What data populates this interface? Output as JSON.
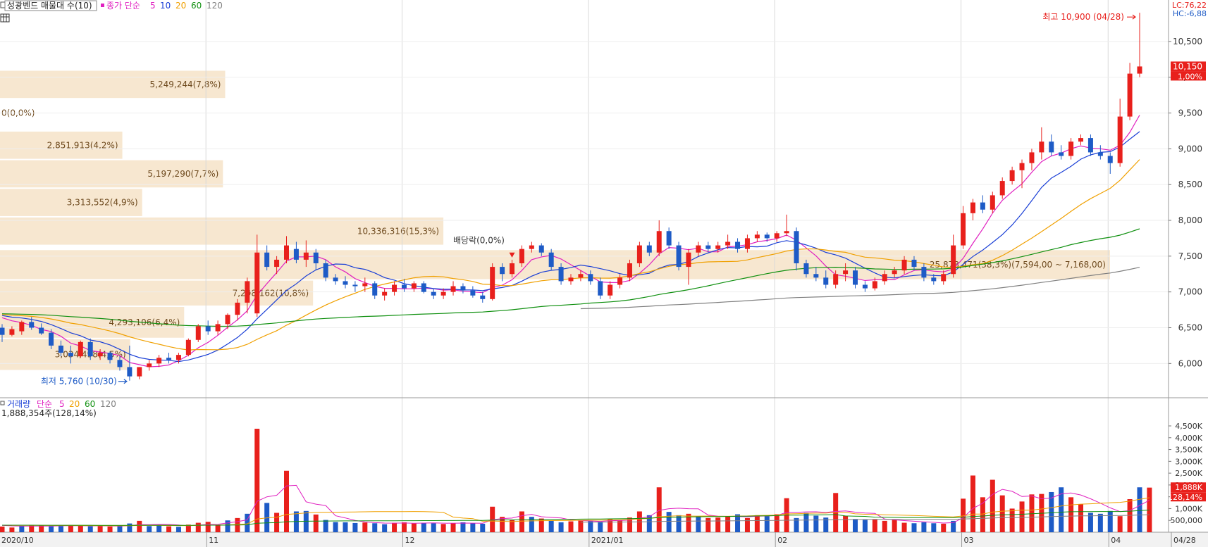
{
  "price_header": {
    "title": "성광벤드 매물대 수(10)",
    "ma_title": "종가 단순",
    "ma_periods": [
      "5",
      "10",
      "20",
      "60",
      "120"
    ],
    "ma_colors": [
      "#e020c0",
      "#1a3fd6",
      "#f0a000",
      "#109010",
      "#808080"
    ]
  },
  "volume_header": {
    "title": "거래량",
    "ma_title": "단순",
    "ma_periods": [
      "5",
      "20",
      "60",
      "120"
    ],
    "ma_colors": [
      "#e020c0",
      "#f0a000",
      "#109010",
      "#808080"
    ],
    "current": "1,888,354주(128,14%)"
  },
  "right_labels": {
    "lc": "LC:76,22",
    "hc": "HC:-6,88",
    "price_tag": "10,150",
    "pct_tag": "1,00%",
    "vol_tag": "1,888K",
    "vol_pct_tag": "128,14%"
  },
  "annotations": {
    "high": "최고 10,900 (04/28)",
    "low": "최저 5,760 (10/30)",
    "dividend": "배당락(0,0%)"
  },
  "colors": {
    "up": "#e8201c",
    "down": "#1e5bc6",
    "volume_profile": "#f7e7d0",
    "volume_profile_text": "#6e4a1e"
  },
  "chart_data": {
    "type": "candlestick",
    "x_axis_labels": [
      "2020/10",
      "11",
      "12",
      "2021/01",
      "02",
      "03",
      "04",
      "04/28"
    ],
    "y_price_ticks": [
      "10,500",
      "10,000",
      "9,500",
      "9,000",
      "8,500",
      "8,000",
      "7,500",
      "7,000",
      "6,500",
      "6,000"
    ],
    "y_volume_ticks": [
      "4,500K",
      "4,000K",
      "3,500K",
      "3,000K",
      "2,500K",
      "2,000K",
      "1,500K",
      "1,000K",
      "500,000"
    ],
    "price_range": [
      5600,
      11000
    ],
    "volume_range": [
      0,
      4500000
    ],
    "volume_profile": [
      {
        "label": "5,249,244(7,8%)",
        "lo": 9700,
        "hi": 10100
      },
      {
        "label": "0(0,0%)",
        "lo": 9300,
        "hi": 9700
      },
      {
        "label": "2,851,913(4,2%)",
        "lo": 8850,
        "hi": 9250
      },
      {
        "label": "5,197,290(7,7%)",
        "lo": 8450,
        "hi": 8850
      },
      {
        "label": "3,313,552(4,9%)",
        "lo": 8050,
        "hi": 8450
      },
      {
        "label": "10,336,316(15,3%)",
        "lo": 7650,
        "hi": 8050
      },
      {
        "label": "25,878,471(38,3%)(7,594,00 ~ 7,168,00)",
        "lo": 7168,
        "hi": 7594
      },
      {
        "label": "7,298,162(10,8%)",
        "lo": 6800,
        "hi": 7168
      },
      {
        "label": "4,293,106(6,4%)",
        "lo": 6350,
        "hi": 6800
      },
      {
        "label": "3,034,498(4,5%)",
        "lo": 5900,
        "hi": 6350
      }
    ],
    "ohlc": [
      [
        6500,
        6550,
        6300,
        6400
      ],
      [
        6400,
        6520,
        6380,
        6480
      ],
      [
        6450,
        6600,
        6400,
        6580
      ],
      [
        6580,
        6650,
        6470,
        6500
      ],
      [
        6500,
        6560,
        6400,
        6420
      ],
      [
        6430,
        6480,
        6200,
        6250
      ],
      [
        6250,
        6320,
        6100,
        6150
      ],
      [
        6150,
        6250,
        6000,
        6100
      ],
      [
        6100,
        6320,
        6080,
        6300
      ],
      [
        6300,
        6350,
        6050,
        6100
      ],
      [
        6100,
        6200,
        6050,
        6150
      ],
      [
        6150,
        6170,
        6000,
        6050
      ],
      [
        6050,
        6100,
        5900,
        5950
      ],
      [
        5950,
        6250,
        5760,
        5820
      ],
      [
        5820,
        5950,
        5780,
        5950
      ],
      [
        5950,
        6050,
        5900,
        6000
      ],
      [
        6000,
        6120,
        5950,
        6080
      ],
      [
        6080,
        6150,
        6000,
        6050
      ],
      [
        6050,
        6150,
        6000,
        6120
      ],
      [
        6120,
        6350,
        6100,
        6330
      ],
      [
        6330,
        6550,
        6300,
        6520
      ],
      [
        6520,
        6600,
        6400,
        6450
      ],
      [
        6450,
        6600,
        6400,
        6550
      ],
      [
        6550,
        6700,
        6480,
        6680
      ],
      [
        6680,
        6900,
        6600,
        6850
      ],
      [
        6850,
        7200,
        6700,
        7150
      ],
      [
        6700,
        7800,
        6650,
        7550
      ],
      [
        7550,
        7650,
        7300,
        7350
      ],
      [
        7350,
        7500,
        7250,
        7450
      ],
      [
        7450,
        7780,
        7400,
        7650
      ],
      [
        7600,
        7700,
        7400,
        7450
      ],
      [
        7450,
        7720,
        7350,
        7550
      ],
      [
        7550,
        7600,
        7300,
        7400
      ],
      [
        7400,
        7450,
        7150,
        7200
      ],
      [
        7200,
        7250,
        7100,
        7150
      ],
      [
        7150,
        7220,
        7050,
        7100
      ],
      [
        7100,
        7150,
        7000,
        7080
      ],
      [
        7080,
        7200,
        7000,
        7120
      ],
      [
        7120,
        7150,
        6900,
        6950
      ],
      [
        6950,
        7050,
        6880,
        7000
      ],
      [
        7000,
        7150,
        6950,
        7100
      ],
      [
        7100,
        7180,
        7000,
        7050
      ],
      [
        7050,
        7150,
        7000,
        7120
      ],
      [
        7120,
        7150,
        6980,
        7000
      ],
      [
        7000,
        7050,
        6900,
        6950
      ],
      [
        6950,
        7050,
        6900,
        7000
      ],
      [
        7000,
        7150,
        6950,
        7080
      ],
      [
        7080,
        7120,
        6980,
        7020
      ],
      [
        7020,
        7080,
        6920,
        6950
      ],
      [
        6950,
        7000,
        6850,
        6900
      ],
      [
        6900,
        7400,
        6880,
        7350
      ],
      [
        7350,
        7400,
        7150,
        7250
      ],
      [
        7250,
        7450,
        7200,
        7400
      ],
      [
        7400,
        7650,
        7350,
        7600
      ],
      [
        7600,
        7700,
        7550,
        7650
      ],
      [
        7650,
        7680,
        7500,
        7550
      ],
      [
        7550,
        7600,
        7300,
        7350
      ],
      [
        7350,
        7400,
        7100,
        7150
      ],
      [
        7150,
        7250,
        7100,
        7200
      ],
      [
        7200,
        7300,
        7150,
        7250
      ],
      [
        7250,
        7300,
        7100,
        7150
      ],
      [
        7150,
        7200,
        6900,
        6950
      ],
      [
        6950,
        7150,
        6900,
        7100
      ],
      [
        7100,
        7250,
        7050,
        7200
      ],
      [
        7200,
        7450,
        7150,
        7400
      ],
      [
        7400,
        7700,
        7350,
        7650
      ],
      [
        7650,
        7700,
        7500,
        7550
      ],
      [
        7550,
        8000,
        7500,
        7850
      ],
      [
        7850,
        7900,
        7600,
        7650
      ],
      [
        7650,
        7700,
        7300,
        7350
      ],
      [
        7350,
        7600,
        7100,
        7550
      ],
      [
        7550,
        7700,
        7500,
        7650
      ],
      [
        7650,
        7700,
        7550,
        7600
      ],
      [
        7600,
        7700,
        7550,
        7650
      ],
      [
        7650,
        7800,
        7600,
        7700
      ],
      [
        7700,
        7750,
        7550,
        7600
      ],
      [
        7600,
        7800,
        7550,
        7750
      ],
      [
        7750,
        7850,
        7700,
        7800
      ],
      [
        7800,
        7830,
        7700,
        7750
      ],
      [
        7750,
        7850,
        7700,
        7820
      ],
      [
        7820,
        8080,
        7780,
        7850
      ],
      [
        7850,
        7900,
        7300,
        7400
      ],
      [
        7400,
        7450,
        7200,
        7250
      ],
      [
        7250,
        7350,
        7150,
        7200
      ],
      [
        7200,
        7300,
        7050,
        7100
      ],
      [
        7100,
        7300,
        7050,
        7250
      ],
      [
        7250,
        7400,
        7150,
        7300
      ],
      [
        7300,
        7350,
        7050,
        7100
      ],
      [
        7100,
        7150,
        7000,
        7050
      ],
      [
        7050,
        7200,
        7020,
        7150
      ],
      [
        7150,
        7300,
        7100,
        7250
      ],
      [
        7250,
        7350,
        7200,
        7300
      ],
      [
        7300,
        7500,
        7250,
        7450
      ],
      [
        7450,
        7500,
        7300,
        7350
      ],
      [
        7350,
        7400,
        7150,
        7200
      ],
      [
        7200,
        7250,
        7100,
        7150
      ],
      [
        7150,
        7300,
        7100,
        7250
      ],
      [
        7250,
        7800,
        7200,
        7650
      ],
      [
        7650,
        8200,
        7600,
        8100
      ],
      [
        8100,
        8300,
        8000,
        8250
      ],
      [
        8250,
        8350,
        8100,
        8150
      ],
      [
        8150,
        8400,
        8100,
        8350
      ],
      [
        8350,
        8600,
        8300,
        8550
      ],
      [
        8550,
        8750,
        8500,
        8700
      ],
      [
        8700,
        8850,
        8450,
        8800
      ],
      [
        8800,
        9000,
        8700,
        8950
      ],
      [
        8950,
        9300,
        8850,
        9100
      ],
      [
        9100,
        9200,
        8900,
        8950
      ],
      [
        8950,
        9050,
        8850,
        8900
      ],
      [
        8900,
        9150,
        8850,
        9100
      ],
      [
        9100,
        9200,
        9050,
        9150
      ],
      [
        9150,
        9200,
        8900,
        8950
      ],
      [
        8950,
        9050,
        8850,
        8900
      ],
      [
        8900,
        8950,
        8650,
        8800
      ],
      [
        8800,
        9700,
        8750,
        9450
      ],
      [
        9450,
        10200,
        9400,
        10050
      ],
      [
        10050,
        10900,
        10000,
        10150
      ]
    ],
    "volume": [
      240000,
      200000,
      260000,
      310000,
      280000,
      250000,
      260000,
      300000,
      280000,
      250000,
      260000,
      240000,
      260000,
      370000,
      480000,
      260000,
      300000,
      250000,
      230000,
      320000,
      400000,
      440000,
      300000,
      500000,
      600000,
      780000,
      4380000,
      1240000,
      820000,
      2600000,
      880000,
      900000,
      750000,
      520000,
      430000,
      420000,
      390000,
      410000,
      380000,
      340000,
      400000,
      420000,
      370000,
      400000,
      380000,
      350000,
      390000,
      420000,
      380000,
      360000,
      1080000,
      650000,
      520000,
      880000,
      650000,
      580000,
      500000,
      420000,
      460000,
      520000,
      480000,
      420000,
      560000,
      500000,
      620000,
      880000,
      720000,
      1900000,
      860000,
      720000,
      780000,
      680000,
      600000,
      620000,
      680000,
      760000,
      600000,
      720000,
      680000,
      760000,
      1440000,
      600000,
      820000,
      700000,
      620000,
      1660000,
      700000,
      560000,
      520000,
      540000,
      480000,
      520000,
      400000,
      380000,
      420000,
      380000,
      360000,
      480000,
      1420000,
      2400000,
      1480000,
      2220000,
      1560000,
      1000000,
      1300000,
      1600000,
      1620000,
      1700000,
      1900000,
      1480000,
      1180000,
      820000,
      780000,
      900000,
      680000,
      1400000,
      1900000,
      1888354
    ],
    "volume_up": [
      true,
      true,
      false,
      true,
      true,
      false,
      false,
      true,
      true,
      false,
      true,
      true,
      false,
      false,
      true,
      false,
      false,
      true,
      false,
      true,
      true,
      true,
      true,
      false,
      true,
      false,
      true,
      false,
      true,
      true,
      false,
      false,
      true,
      false,
      false,
      false,
      false,
      true,
      false,
      false,
      true,
      true,
      true,
      false,
      false,
      true,
      true,
      false,
      false,
      false,
      true,
      true,
      true,
      true,
      false,
      true,
      false,
      false,
      true,
      true,
      false,
      false,
      true,
      true,
      true,
      true,
      false,
      true,
      false,
      false,
      true,
      false,
      true,
      true,
      true,
      false,
      true,
      true,
      false,
      true,
      true,
      false,
      false,
      false,
      false,
      true,
      true,
      false,
      false,
      true,
      true,
      true,
      true,
      false,
      false,
      false,
      true,
      false,
      true,
      true,
      true,
      true,
      true,
      true,
      true,
      true,
      true,
      false,
      false,
      true,
      true,
      false,
      false,
      false,
      true,
      true,
      false,
      true
    ]
  }
}
